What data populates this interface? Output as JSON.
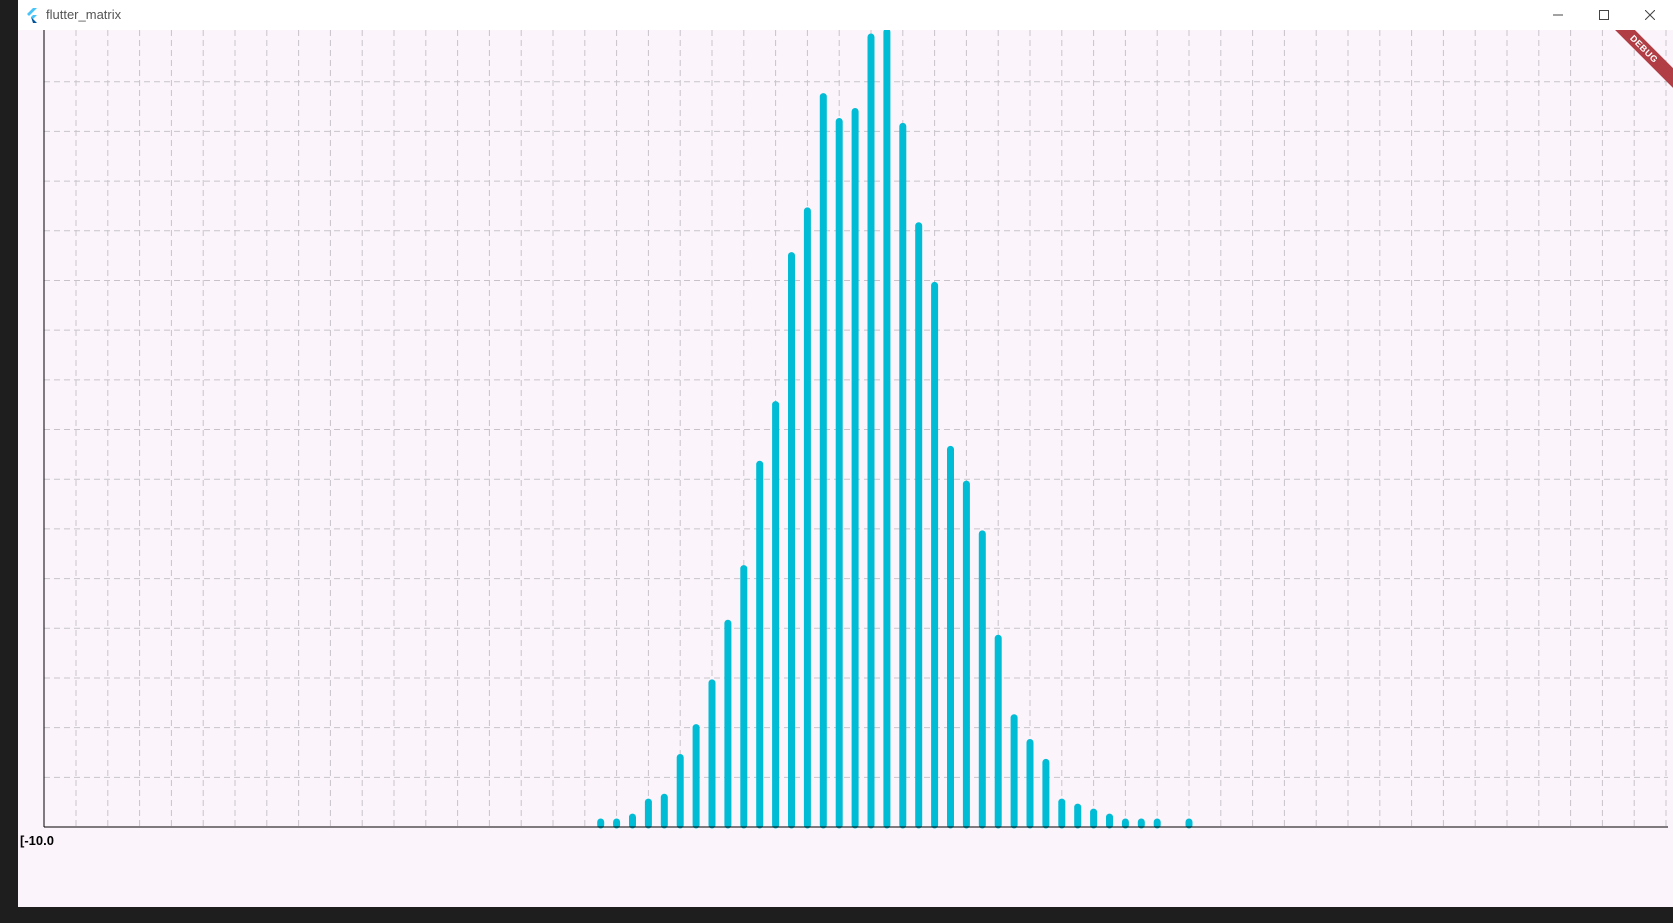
{
  "window": {
    "title": "flutter_matrix",
    "controls": {
      "minimize": "—",
      "maximize": "☐",
      "close": "✕"
    },
    "debug_banner": "DEBUG"
  },
  "colors": {
    "bar": "#00bcd4",
    "plot_bg": "#fbf4fb",
    "grid": "#c8c3cb",
    "axis": "#000000",
    "banner": "#b13d45"
  },
  "chart_data": {
    "type": "bar",
    "grid": true,
    "legend": "none",
    "title": "",
    "xlabel": "",
    "ylabel": "",
    "ylim": [
      0,
      160
    ],
    "first_x_tick_label": "[-10.0",
    "bar_start_index": 33,
    "values": [
      1,
      1,
      2,
      5,
      6,
      14,
      20,
      29,
      41,
      52,
      73,
      85,
      115,
      124,
      147,
      142,
      144,
      159,
      160,
      141,
      121,
      109,
      76,
      69,
      59,
      38,
      22,
      17,
      13,
      5,
      4,
      3,
      2,
      1,
      1,
      1,
      0,
      1
    ]
  }
}
